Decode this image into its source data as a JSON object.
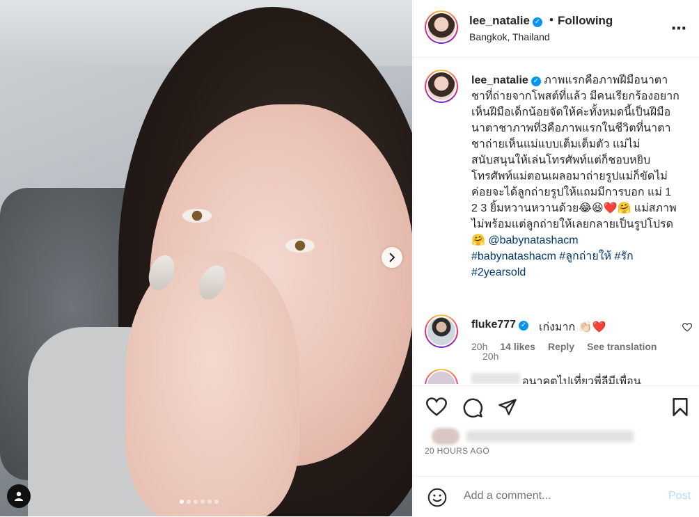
{
  "post": {
    "username": "lee_natalie",
    "verified_mark": "✓",
    "separator": "•",
    "follow_status": "Following",
    "location": "Bangkok, Thailand",
    "more_icon": "⋯"
  },
  "media": {
    "carousel_dots": 6,
    "active_dot": 0,
    "next_icon": "chevron-right-icon",
    "tag_icon": "user-tag-icon"
  },
  "caption": {
    "username": "lee_natalie",
    "text": "ภาพแรกคือภาพฝีมือนาตาชาที่ถ่ายจากโพสต์ที่แล้ว มีคนเรียกร้องอยากเห็นฝีมือเด็กน้อยจัดให้ค่ะทั้งหมดนี้เป็นฝีมือนาตาชาภาพที่3คือภาพแรกในชีวิตที่นาตาชาถ่ายเห็นแม่แบบเต็มเต็มตัว แม่ไม่สนับสนุนให้เล่นโทรศัพท์แต่ก็ชอบหยิบโทรศัพท์แม่ตอนเผลอมาถ่ายรูปแม่ก็ขัดไม่ค่อยจะได้ลูกถ่ายรูปให้แถมมีการบอก แม่ 1 2 3 ยิ้มหวานหวานด้วย😂😆❤️🤗 แม่สภาพไม่พร้อมแต่ลูกถ่ายให้เลยกลายเป็นรูปโปรด🤗",
    "mention": "@babynatashacm",
    "hashtags": "#babynatashacm #ลูกถ่ายให้ #รัก #2yearsold",
    "time": "20h"
  },
  "comments": [
    {
      "username": "fluke777",
      "text": "เก่งมาก 👏🏻❤️",
      "time": "20h",
      "likes": "14 likes",
      "reply": "Reply",
      "translate": "See translation"
    },
    {
      "text": "อนาคตไปเที่ยวพี่ลีมีเพื่อน"
    }
  ],
  "actions": {
    "icons": [
      "heart-icon",
      "comment-icon",
      "share-icon",
      "bookmark-icon"
    ],
    "date": "20 HOURS AGO"
  },
  "add_comment": {
    "placeholder": "Add a comment...",
    "post_label": "Post"
  },
  "colors": {
    "link_blue": "#00376b",
    "verified_blue": "#0095f6",
    "post_disabled": "#b3dbff",
    "muted": "#737373"
  }
}
